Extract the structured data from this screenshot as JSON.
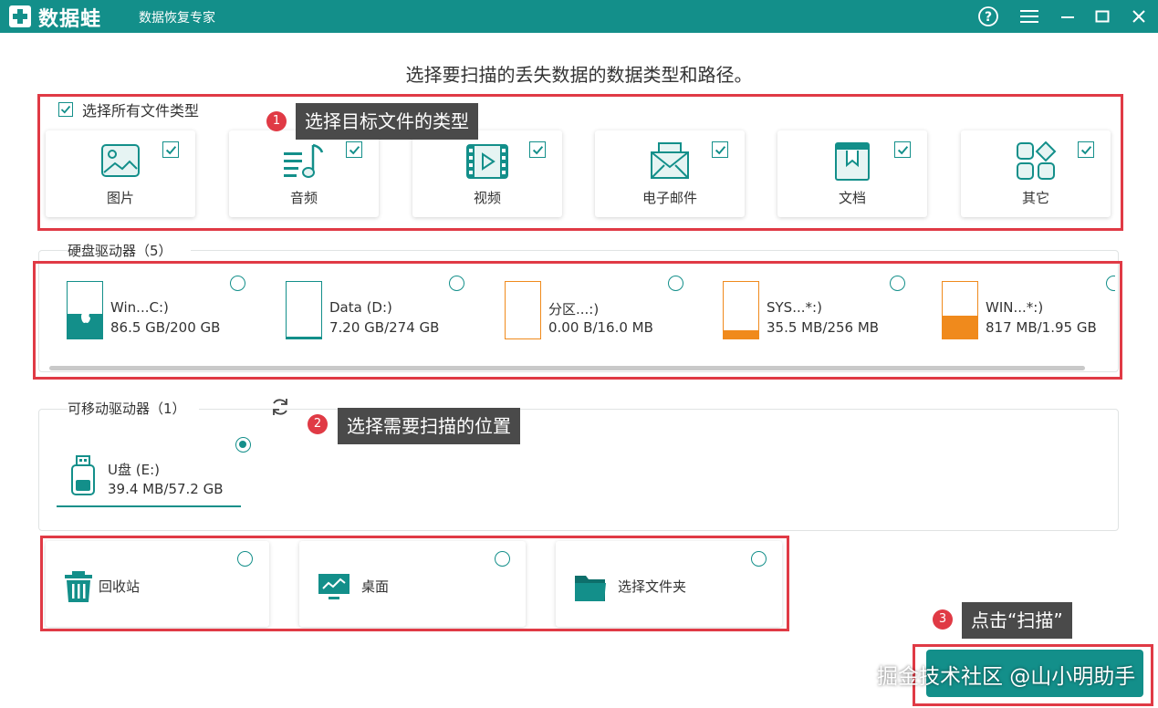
{
  "app": {
    "logo_text": "数据蛙",
    "subtitle": "数据恢复专家",
    "colors": {
      "primary": "#138f8a",
      "highlight": "#e03a45",
      "orange": "#f08a1c",
      "tooltip": "#4a4a4a"
    }
  },
  "titlebar_icons": [
    "help-icon",
    "menu-icon",
    "minimize-icon",
    "maximize-icon",
    "close-icon"
  ],
  "heading": "选择要扫描的丢失数据的数据类型和路径。",
  "file_types": {
    "select_all_label": "选择所有文件类型",
    "select_all_checked": true,
    "items": [
      {
        "label": "图片",
        "icon": "image-icon",
        "checked": true
      },
      {
        "label": "音频",
        "icon": "music-icon",
        "checked": true
      },
      {
        "label": "视频",
        "icon": "video-icon",
        "checked": true
      },
      {
        "label": "电子邮件",
        "icon": "email-icon",
        "checked": true
      },
      {
        "label": "文档",
        "icon": "document-icon",
        "checked": true
      },
      {
        "label": "其它",
        "icon": "other-icon",
        "checked": true
      }
    ]
  },
  "hard_drives": {
    "title": "硬盘驱动器（5）",
    "items": [
      {
        "name": "Win...C:)",
        "size": "86.5 GB/200 GB",
        "used_fraction": 0.43,
        "color": "#138f8a",
        "os_logo": true,
        "selected": false
      },
      {
        "name": "Data (D:)",
        "size": "7.20 GB/274 GB",
        "used_fraction": 0.03,
        "color": "#138f8a",
        "os_logo": false,
        "selected": false
      },
      {
        "name": "分区...:)",
        "size": "0.00  B/16.0 MB",
        "used_fraction": 0.0,
        "color": "#f08a1c",
        "os_logo": false,
        "selected": false
      },
      {
        "name": "SYS...*:)",
        "size": "35.5 MB/256 MB",
        "used_fraction": 0.14,
        "color": "#f08a1c",
        "os_logo": false,
        "selected": false
      },
      {
        "name": "WIN...*:)",
        "size": "817 MB/1.95 GB",
        "used_fraction": 0.41,
        "color": "#f08a1c",
        "os_logo": false,
        "selected": false
      }
    ]
  },
  "removable_drives": {
    "title": "可移动驱动器（1）",
    "refresh_icon": "refresh-icon",
    "items": [
      {
        "name": "U盘 (E:)",
        "size": "39.4 MB/57.2 GB",
        "icon": "usb-drive-icon",
        "selected": true
      }
    ]
  },
  "locations": {
    "items": [
      {
        "label": "回收站",
        "icon": "recycle-bin-icon",
        "selected": false
      },
      {
        "label": "桌面",
        "icon": "desktop-icon",
        "selected": false
      },
      {
        "label": "选择文件夹",
        "icon": "folder-icon",
        "selected": false
      }
    ]
  },
  "tips": [
    {
      "number": "1",
      "text": "选择目标文件的类型"
    },
    {
      "number": "2",
      "text": "选择需要扫描的位置"
    },
    {
      "number": "3",
      "text": "点击“扫描”"
    }
  ],
  "scan_button": {
    "label": ""
  },
  "watermark": "掘金技术社区 @山小明助手"
}
